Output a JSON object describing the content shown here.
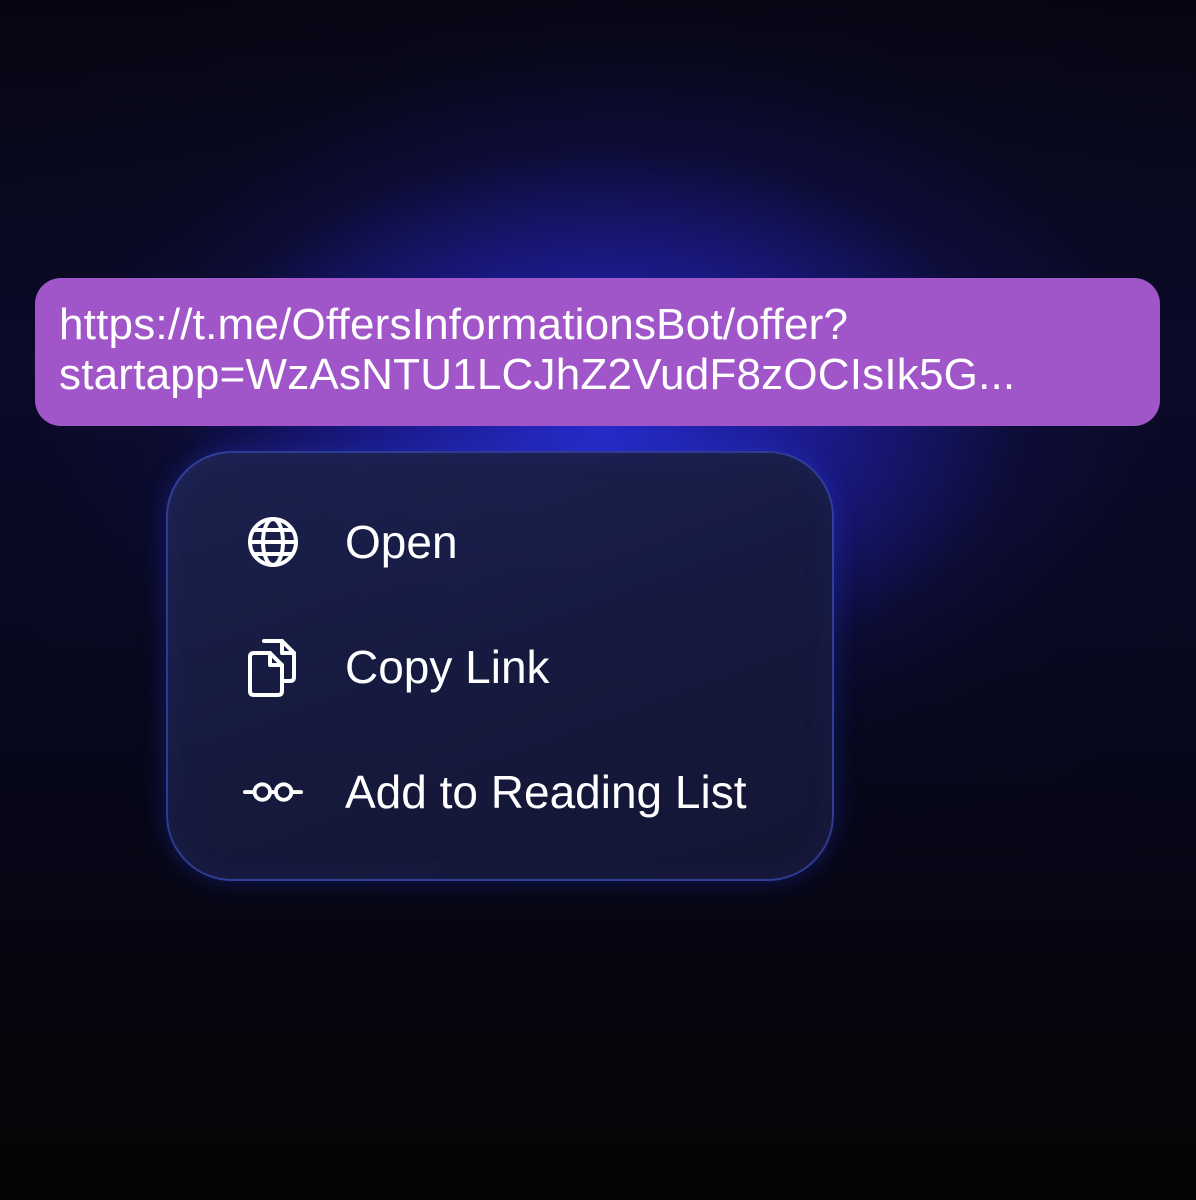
{
  "link_preview": {
    "line1": "https://t.me/OffersInformationsBot/offer?",
    "line2": "startapp=WzAsNTU1LCJhZ2VudF8zOCIsIk5G..."
  },
  "context_menu": {
    "items": [
      {
        "label": "Open",
        "icon": "globe-icon"
      },
      {
        "label": "Copy Link",
        "icon": "copy-icon"
      },
      {
        "label": "Add to Reading List",
        "icon": "glasses-icon"
      }
    ]
  },
  "colors": {
    "bubble": "#a056c8",
    "menu_background": "#1a1f4a",
    "menu_border": "#4658dc",
    "text": "#ffffff"
  }
}
